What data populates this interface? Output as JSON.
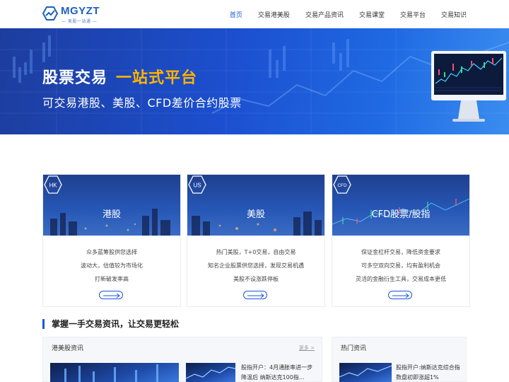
{
  "header": {
    "logo_text": "MGYZT",
    "logo_sub": "— 美股一站通 —",
    "nav": [
      "首页",
      "交易港美股",
      "交易产品资讯",
      "交易课堂",
      "交易平台",
      "交易知识"
    ],
    "active_index": 0
  },
  "banner": {
    "title_main": "股票交易",
    "title_highlight": "一站式平台",
    "subtitle": "可交易港股、美股、CFD差价合约股票",
    "slides": 3,
    "active_slide": 0,
    "colors": {
      "highlight": "#ffb400",
      "background": "#1c4fcf"
    }
  },
  "cards": [
    {
      "badge": "HK",
      "title": "港股",
      "lines": [
        "众多蓝筹股供您选择",
        "波动大，估值较为市场化",
        "打新破发率高"
      ]
    },
    {
      "badge": "US",
      "title": "美股",
      "lines": [
        "热门美股，T+0交易，自由交易",
        "知名企业股票供您选择，发现交易机遇",
        "美股不设涨跌停板"
      ]
    },
    {
      "badge": "CFD",
      "title": "CFD股票/股指",
      "lines": [
        "保证金杠杆交易，降低资金要求",
        "可多空双向交易，均有盈利机会",
        "灵活的金融衍生工具，交易成本更低"
      ]
    }
  ],
  "section": {
    "title": "掌握一手交易资讯，让交易更轻松"
  },
  "news": {
    "left_title": "港美股资讯",
    "more": "更多 >",
    "left_item": "股指开户：4月通胀率进一步降温后 纳斯达克100指…",
    "right_title": "热门资讯",
    "right_item": "股指开户:纳斯达克综合指数盘初即涨超1%"
  },
  "colors": {
    "accent": "#1a56db"
  }
}
